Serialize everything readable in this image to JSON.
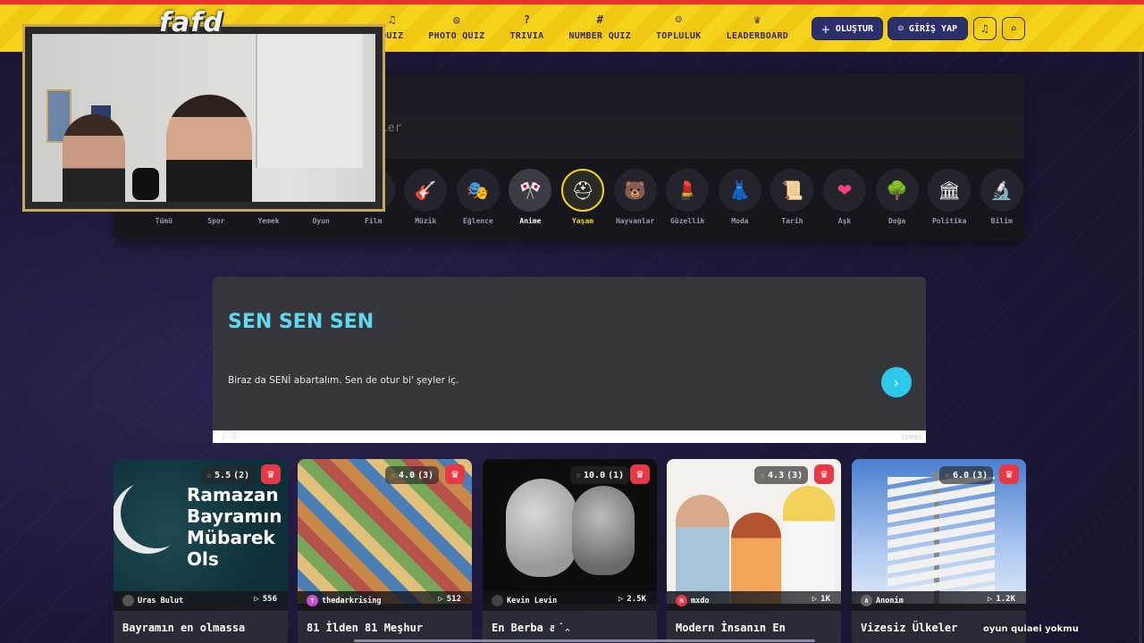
{
  "nav": [
    {
      "icon": "♫",
      "label": "QUIZ"
    },
    {
      "icon": "◎",
      "label": "PHOTO QUIZ"
    },
    {
      "icon": "?",
      "label": "TRIVIA"
    },
    {
      "icon": "#",
      "label": "NUMBER QUIZ"
    },
    {
      "icon": "☺",
      "label": "TOPLULUK"
    },
    {
      "icon": "♛",
      "label": "LEADERBOARD"
    }
  ],
  "header": {
    "create_label": "OLUŞTUR",
    "login_label": "GİRİŞ YAP"
  },
  "webcam": {
    "logo": "fafd"
  },
  "search": {
    "placeholder_fragment": "zler"
  },
  "categories": [
    {
      "icon": "",
      "label": "Tümü"
    },
    {
      "icon": "",
      "label": "Spor"
    },
    {
      "icon": "",
      "label": "Yemek"
    },
    {
      "icon": "",
      "label": "Oyun"
    },
    {
      "icon": "🎬",
      "label": "Film"
    },
    {
      "icon": "🎸",
      "label": "Müzik"
    },
    {
      "icon": "🎭",
      "label": "Eğlence"
    },
    {
      "icon": "🎌",
      "label": "Anime"
    },
    {
      "icon": "⛑",
      "label": "Yaşam"
    },
    {
      "icon": "🐻",
      "label": "Hayvanlar"
    },
    {
      "icon": "💄",
      "label": "Güzellik"
    },
    {
      "icon": "👗",
      "label": "Moda"
    },
    {
      "icon": "📜",
      "label": "Tarih"
    },
    {
      "icon": "❤",
      "label": "Aşk"
    },
    {
      "icon": "🌳",
      "label": "Doğa"
    },
    {
      "icon": "🏛",
      "label": "Politika"
    },
    {
      "icon": "🔬",
      "label": "Bilim"
    }
  ],
  "banner": {
    "title": "SEN SEN SEN",
    "description": "Biraz da SENİ abartalım. Sen de otur bi' şeyler iç.",
    "ad_brand": "DIMES"
  },
  "cards": [
    {
      "rating": "5.5",
      "count": "(2)",
      "author": "Uras Bulut",
      "avatar": "",
      "plays": "556",
      "title": "Bayramın en olmassa",
      "thumb_text": "Ramazan Bayramın Mübarek Ols"
    },
    {
      "rating": "4.0",
      "count": "(3)",
      "author": "thedarkrising",
      "avatar": "T",
      "plays": "512",
      "title": "81 İlden 81 Meşhur",
      "thumb_text": ""
    },
    {
      "rating": "10.0",
      "count": "(1)",
      "author": "Kevin Levin",
      "avatar": "",
      "plays": "2.5K",
      "title": "En Berba   adaş",
      "thumb_text": ""
    },
    {
      "rating": "4.3",
      "count": "(3)",
      "author": "mxdo",
      "avatar": "M",
      "plays": "1K",
      "title": "Modern İnsanın En",
      "thumb_text": ""
    },
    {
      "rating": "6.0",
      "count": "(3)",
      "author": "Anonim",
      "avatar": "A",
      "plays": "1.2K",
      "title": "Vizesiz Ülkeler",
      "thumb_text": ""
    }
  ],
  "overlay": {
    "red_text": "",
    "white_text": "oyun quiaei yokmu"
  },
  "colors": {
    "topbar_yellow": "#f5d21b",
    "topbar_red": "#e8322b",
    "nav_text": "#3b2a6b",
    "button_navy": "#2c2f6b",
    "banner_title": "#5fd8ef",
    "crown_red": "#e63946"
  }
}
